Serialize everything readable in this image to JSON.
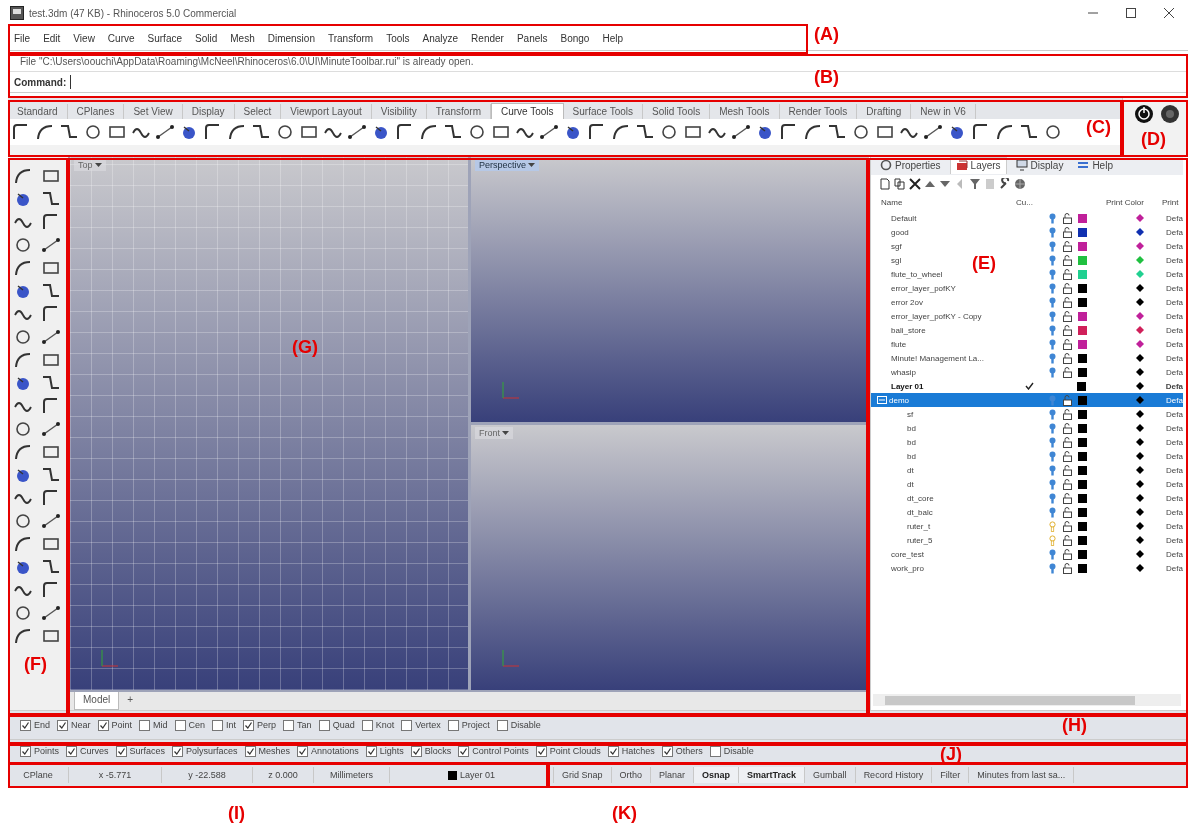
{
  "window": {
    "title": "test.3dm (47 KB) - Rhinoceros 5.0 Commercial"
  },
  "menu": [
    "File",
    "Edit",
    "View",
    "Curve",
    "Surface",
    "Solid",
    "Mesh",
    "Dimension",
    "Transform",
    "Tools",
    "Analyze",
    "Render",
    "Panels",
    "Bongo",
    "Help"
  ],
  "command_history": "File \"C:\\Users\\oouchi\\AppData\\Roaming\\McNeel\\Rhinoceros\\6.0\\UI\\MinuteToolbar.rui\" is already open.",
  "command": {
    "label": "Command:"
  },
  "toolbar_tabs": [
    {
      "label": "Standard",
      "selected": false
    },
    {
      "label": "CPlanes",
      "selected": false
    },
    {
      "label": "Set View",
      "selected": false
    },
    {
      "label": "Display",
      "selected": false
    },
    {
      "label": "Select",
      "selected": false
    },
    {
      "label": "Viewport Layout",
      "selected": false
    },
    {
      "label": "Visibility",
      "selected": false
    },
    {
      "label": "Transform",
      "selected": false
    },
    {
      "label": "Curve Tools",
      "selected": true
    },
    {
      "label": "Surface Tools",
      "selected": false
    },
    {
      "label": "Solid Tools",
      "selected": false
    },
    {
      "label": "Mesh Tools",
      "selected": false
    },
    {
      "label": "Render Tools",
      "selected": false
    },
    {
      "label": "Drafting",
      "selected": false
    },
    {
      "label": "New in V6",
      "selected": false
    }
  ],
  "viewports": [
    {
      "title": "Top",
      "selected": false
    },
    {
      "title": "Perspective",
      "selected": true
    },
    {
      "title": "Front",
      "selected": false
    }
  ],
  "model_tabs": [
    {
      "label": "Model",
      "selected": true
    },
    {
      "label": "+",
      "selected": false
    }
  ],
  "panel": {
    "tabs": [
      {
        "label": "Properties",
        "selected": false
      },
      {
        "label": "Layers",
        "selected": true
      },
      {
        "label": "Display",
        "selected": false
      },
      {
        "label": "Help",
        "selected": false
      }
    ],
    "columns": [
      "Name",
      "Cu...",
      "Print Color",
      "Print"
    ],
    "layers": [
      {
        "name": "Default",
        "color": "#c0209a",
        "on": true,
        "current": false,
        "selected": false,
        "print": "Defa"
      },
      {
        "name": "good",
        "color": "#1030b0",
        "on": true,
        "current": false,
        "selected": false,
        "print": "Defa"
      },
      {
        "name": "sgf",
        "color": "#c0209a",
        "on": true,
        "current": false,
        "selected": false,
        "print": "Defa"
      },
      {
        "name": "sgl",
        "color": "#20c040",
        "on": true,
        "current": false,
        "selected": false,
        "print": "Defa"
      },
      {
        "name": "flute_to_wheel",
        "color": "#20d090",
        "on": true,
        "current": false,
        "selected": false,
        "print": "Defa"
      },
      {
        "name": "error_layer_pofKY",
        "color": "#000000",
        "on": true,
        "current": false,
        "selected": false,
        "print": "Defa"
      },
      {
        "name": "error 2ov",
        "color": "#000000",
        "on": true,
        "current": false,
        "selected": false,
        "print": "Defa"
      },
      {
        "name": "error_layer_pofKY - Copy",
        "color": "#c0209a",
        "on": true,
        "current": false,
        "selected": false,
        "print": "Defa"
      },
      {
        "name": "bali_store",
        "color": "#d0205a",
        "on": true,
        "current": false,
        "selected": false,
        "print": "Defa"
      },
      {
        "name": "flute",
        "color": "#c0209a",
        "on": true,
        "current": false,
        "selected": false,
        "print": "Defa"
      },
      {
        "name": "Minute! Management La...",
        "color": "#000000",
        "on": true,
        "current": false,
        "selected": false,
        "print": "Defa"
      },
      {
        "name": "whasip",
        "color": "#000000",
        "on": true,
        "current": false,
        "selected": false,
        "print": "Defa"
      },
      {
        "name": "Layer 01",
        "color": "#000000",
        "current": true,
        "selected": false,
        "print": "Defa"
      },
      {
        "name": "demo",
        "color": "#000000",
        "on": true,
        "current": false,
        "selected": true,
        "expanded": true,
        "print": "Defa",
        "children": [
          {
            "name": "sf",
            "color": "#000000",
            "on": true,
            "current": false,
            "selected": false,
            "print": "Defa"
          },
          {
            "name": "bd",
            "color": "#000000",
            "on": true,
            "current": false,
            "selected": false,
            "print": "Defa"
          },
          {
            "name": "bd",
            "color": "#000000",
            "on": true,
            "current": false,
            "selected": false,
            "print": "Defa"
          },
          {
            "name": "bd",
            "color": "#000000",
            "on": true,
            "current": false,
            "selected": false,
            "print": "Defa"
          },
          {
            "name": "dt",
            "color": "#000000",
            "on": true,
            "current": false,
            "selected": false,
            "print": "Defa"
          },
          {
            "name": "dt",
            "color": "#000000",
            "on": true,
            "current": false,
            "selected": false,
            "print": "Defa"
          },
          {
            "name": "dt_core",
            "color": "#000000",
            "on": true,
            "current": false,
            "selected": false,
            "print": "Defa"
          },
          {
            "name": "dt_balc",
            "color": "#000000",
            "on": true,
            "current": false,
            "selected": false,
            "print": "Defa"
          },
          {
            "name": "ruter_t",
            "color": "#000000",
            "on": false,
            "current": false,
            "selected": false,
            "print": "Defa"
          },
          {
            "name": "ruter_5",
            "color": "#000000",
            "on": false,
            "current": false,
            "selected": false,
            "print": "Defa"
          }
        ]
      },
      {
        "name": "core_test",
        "color": "#000000",
        "on": true,
        "current": false,
        "selected": false,
        "print": "Defa"
      },
      {
        "name": "work_pro",
        "color": "#000000",
        "on": true,
        "current": false,
        "selected": false,
        "print": "Defa"
      }
    ]
  },
  "osnap": [
    {
      "label": "End",
      "checked": true
    },
    {
      "label": "Near",
      "checked": true
    },
    {
      "label": "Point",
      "checked": true
    },
    {
      "label": "Mid",
      "checked": false
    },
    {
      "label": "Cen",
      "checked": false
    },
    {
      "label": "Int",
      "checked": false
    },
    {
      "label": "Perp",
      "checked": true
    },
    {
      "label": "Tan",
      "checked": false
    },
    {
      "label": "Quad",
      "checked": false
    },
    {
      "label": "Knot",
      "checked": false
    },
    {
      "label": "Vertex",
      "checked": false
    },
    {
      "label": "Project",
      "checked": false
    },
    {
      "label": "Disable",
      "checked": false
    }
  ],
  "selection_filter": [
    {
      "label": "Points",
      "checked": true
    },
    {
      "label": "Curves",
      "checked": true
    },
    {
      "label": "Surfaces",
      "checked": true
    },
    {
      "label": "Polysurfaces",
      "checked": true
    },
    {
      "label": "Meshes",
      "checked": true
    },
    {
      "label": "Annotations",
      "checked": true
    },
    {
      "label": "Lights",
      "checked": true
    },
    {
      "label": "Blocks",
      "checked": true
    },
    {
      "label": "Control Points",
      "checked": true
    },
    {
      "label": "Point Clouds",
      "checked": true
    },
    {
      "label": "Hatches",
      "checked": true
    },
    {
      "label": "Others",
      "checked": true
    },
    {
      "label": "Disable",
      "checked": false
    }
  ],
  "status_left": [
    {
      "text": "CPlane"
    },
    {
      "text": "x -5.771"
    },
    {
      "text": "y -22.588"
    },
    {
      "text": "z 0.000"
    },
    {
      "text": "Millimeters"
    },
    {
      "text": "Layer 01",
      "color": "#000000"
    }
  ],
  "status_right": [
    {
      "label": "Grid Snap",
      "on": false
    },
    {
      "label": "Ortho",
      "on": false
    },
    {
      "label": "Planar",
      "on": false
    },
    {
      "label": "Osnap",
      "on": true
    },
    {
      "label": "SmartTrack",
      "on": true
    },
    {
      "label": "Gumball",
      "on": false
    },
    {
      "label": "Record History",
      "on": false
    },
    {
      "label": "Filter",
      "on": false
    },
    {
      "label": "Minutes from last sa...",
      "on": false
    }
  ],
  "annotations": [
    {
      "label": "(A)"
    },
    {
      "label": "(B)"
    },
    {
      "label": "(C)"
    },
    {
      "label": "(D)"
    },
    {
      "label": "(E)"
    },
    {
      "label": "(F)"
    },
    {
      "label": "(G)"
    },
    {
      "label": "(H)"
    },
    {
      "label": "(J)"
    },
    {
      "label": "(I)"
    },
    {
      "label": "(K)"
    }
  ]
}
